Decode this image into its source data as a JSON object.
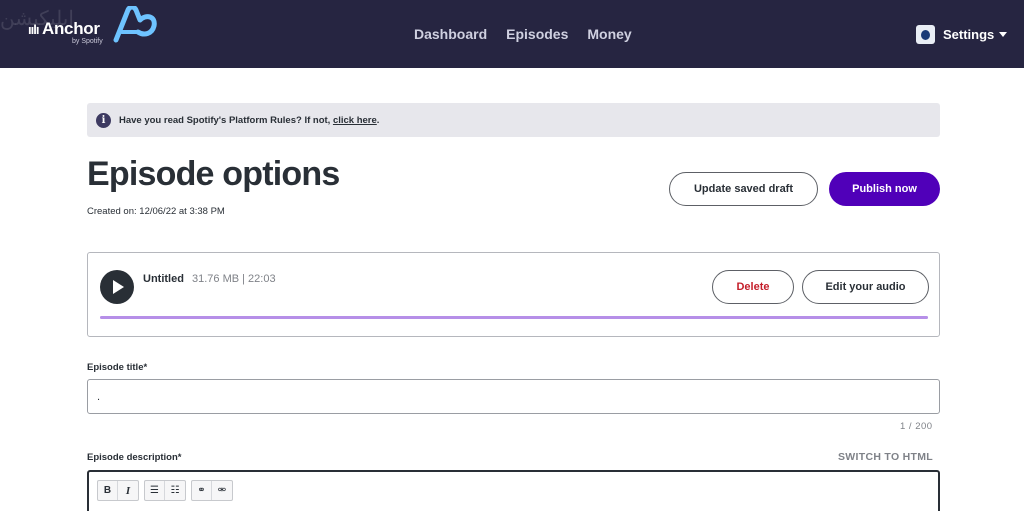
{
  "header": {
    "logo_text": "Anchor",
    "logo_sub": "by Spotify",
    "watermark": "ابلیکیشن",
    "nav": [
      "Dashboard",
      "Episodes",
      "Money"
    ],
    "settings_label": "Settings"
  },
  "alert": {
    "text": "Have you read Spotify's Platform Rules? If not, ",
    "link": "click here",
    "end": "."
  },
  "page": {
    "title": "Episode options",
    "created": "Created on: 12/06/22 at 3:38 PM",
    "update_draft_label": "Update saved draft",
    "publish_label": "Publish now"
  },
  "audio": {
    "name": "Untitled",
    "meta": "31.76 MB | 22:03",
    "delete_label": "Delete",
    "edit_label": "Edit your audio",
    "progress": 1.0
  },
  "form": {
    "title_label": "Episode title*",
    "title_value": ".",
    "counter": "1  /  200",
    "desc_label": "Episode description*",
    "switch_html_label": "SWITCH TO HTML"
  },
  "toolbar": {
    "bold": "B",
    "italic": "I",
    "bullet_list": "☰",
    "numbered_list": "☷",
    "link": "⚭",
    "unlink": "⚮"
  },
  "colors": {
    "header_bg": "#262541",
    "primary": "#5000b9",
    "danger": "#c41e2a",
    "progress": "#b68fe8"
  }
}
